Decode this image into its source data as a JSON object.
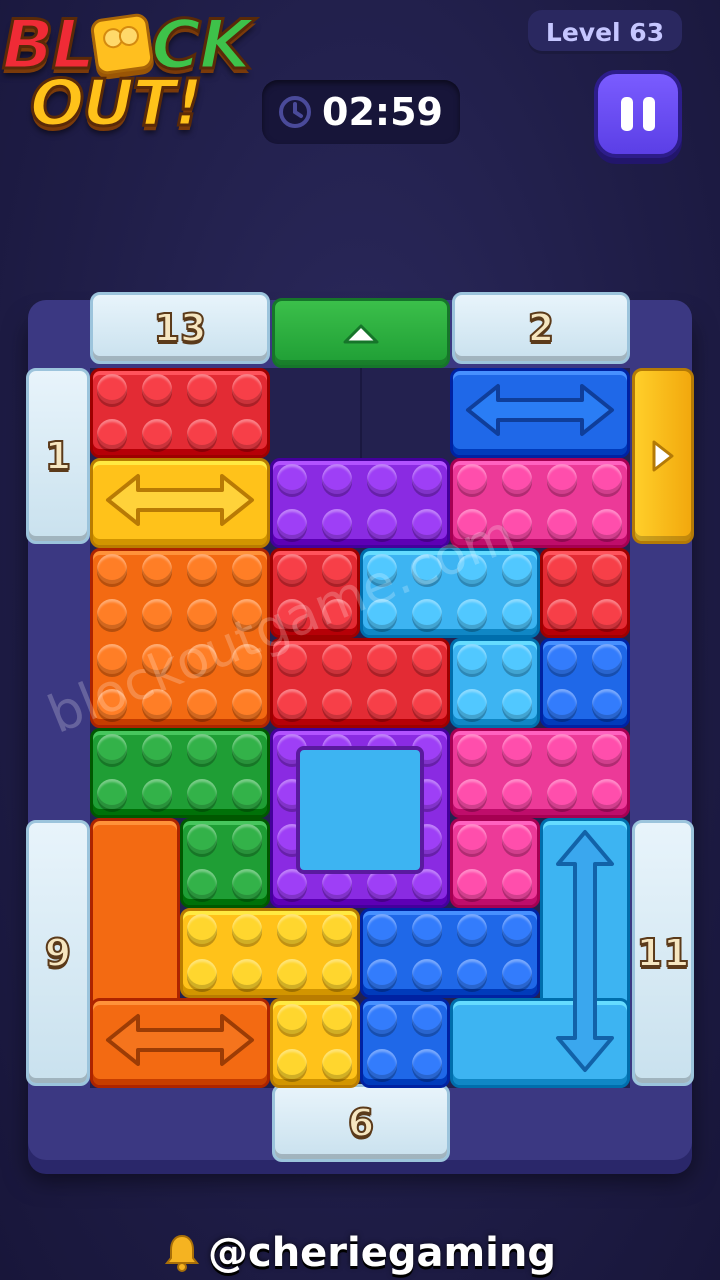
{
  "header": {
    "logo_line1_parts": [
      "BL",
      "CK"
    ],
    "logo_line2": "OUT!",
    "level_label": "Level 63",
    "timer": "02:59",
    "icons": {
      "timer": "clock-icon",
      "pause": "pause-icon"
    }
  },
  "board": {
    "exits": {
      "top_left": "13",
      "top_right": "2",
      "left_top": "1",
      "left_bottom": "9",
      "right_bottom": "11",
      "bottom": "6"
    },
    "open_exits": {
      "top": "green",
      "right": "yellow"
    },
    "colors": {
      "red": "#e32b34",
      "blue": "#1f68e8",
      "yellow": "#ffc21a",
      "purple": "#8a2be2",
      "pink": "#ec3a98",
      "orange": "#f36a12",
      "cyan": "#3db4f2",
      "green": "#1f9e35",
      "frame": "#3b3882",
      "ice": "#dcecf5"
    }
  },
  "watermark": "blockoutgame.com",
  "footer": {
    "handle": "@cheriegaming",
    "icon": "bell-icon"
  }
}
